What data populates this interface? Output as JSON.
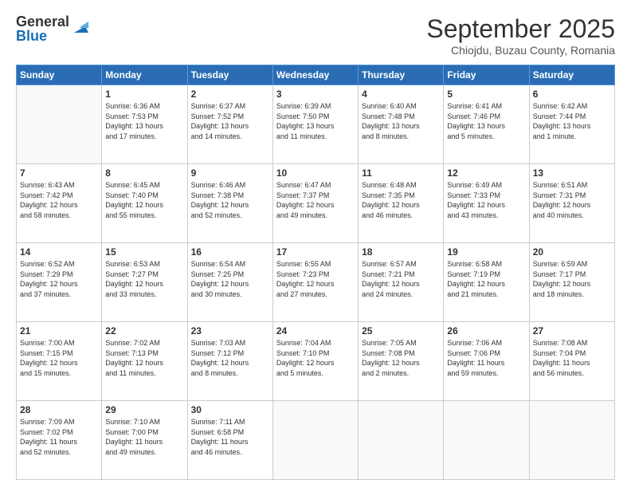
{
  "logo": {
    "general": "General",
    "blue": "Blue"
  },
  "header": {
    "month": "September 2025",
    "location": "Chiojdu, Buzau County, Romania"
  },
  "weekdays": [
    "Sunday",
    "Monday",
    "Tuesday",
    "Wednesday",
    "Thursday",
    "Friday",
    "Saturday"
  ],
  "weeks": [
    [
      {
        "day": "",
        "info": ""
      },
      {
        "day": "1",
        "info": "Sunrise: 6:36 AM\nSunset: 7:53 PM\nDaylight: 13 hours\nand 17 minutes."
      },
      {
        "day": "2",
        "info": "Sunrise: 6:37 AM\nSunset: 7:52 PM\nDaylight: 13 hours\nand 14 minutes."
      },
      {
        "day": "3",
        "info": "Sunrise: 6:39 AM\nSunset: 7:50 PM\nDaylight: 13 hours\nand 11 minutes."
      },
      {
        "day": "4",
        "info": "Sunrise: 6:40 AM\nSunset: 7:48 PM\nDaylight: 13 hours\nand 8 minutes."
      },
      {
        "day": "5",
        "info": "Sunrise: 6:41 AM\nSunset: 7:46 PM\nDaylight: 13 hours\nand 5 minutes."
      },
      {
        "day": "6",
        "info": "Sunrise: 6:42 AM\nSunset: 7:44 PM\nDaylight: 13 hours\nand 1 minute."
      }
    ],
    [
      {
        "day": "7",
        "info": "Sunrise: 6:43 AM\nSunset: 7:42 PM\nDaylight: 12 hours\nand 58 minutes."
      },
      {
        "day": "8",
        "info": "Sunrise: 6:45 AM\nSunset: 7:40 PM\nDaylight: 12 hours\nand 55 minutes."
      },
      {
        "day": "9",
        "info": "Sunrise: 6:46 AM\nSunset: 7:38 PM\nDaylight: 12 hours\nand 52 minutes."
      },
      {
        "day": "10",
        "info": "Sunrise: 6:47 AM\nSunset: 7:37 PM\nDaylight: 12 hours\nand 49 minutes."
      },
      {
        "day": "11",
        "info": "Sunrise: 6:48 AM\nSunset: 7:35 PM\nDaylight: 12 hours\nand 46 minutes."
      },
      {
        "day": "12",
        "info": "Sunrise: 6:49 AM\nSunset: 7:33 PM\nDaylight: 12 hours\nand 43 minutes."
      },
      {
        "day": "13",
        "info": "Sunrise: 6:51 AM\nSunset: 7:31 PM\nDaylight: 12 hours\nand 40 minutes."
      }
    ],
    [
      {
        "day": "14",
        "info": "Sunrise: 6:52 AM\nSunset: 7:29 PM\nDaylight: 12 hours\nand 37 minutes."
      },
      {
        "day": "15",
        "info": "Sunrise: 6:53 AM\nSunset: 7:27 PM\nDaylight: 12 hours\nand 33 minutes."
      },
      {
        "day": "16",
        "info": "Sunrise: 6:54 AM\nSunset: 7:25 PM\nDaylight: 12 hours\nand 30 minutes."
      },
      {
        "day": "17",
        "info": "Sunrise: 6:55 AM\nSunset: 7:23 PM\nDaylight: 12 hours\nand 27 minutes."
      },
      {
        "day": "18",
        "info": "Sunrise: 6:57 AM\nSunset: 7:21 PM\nDaylight: 12 hours\nand 24 minutes."
      },
      {
        "day": "19",
        "info": "Sunrise: 6:58 AM\nSunset: 7:19 PM\nDaylight: 12 hours\nand 21 minutes."
      },
      {
        "day": "20",
        "info": "Sunrise: 6:59 AM\nSunset: 7:17 PM\nDaylight: 12 hours\nand 18 minutes."
      }
    ],
    [
      {
        "day": "21",
        "info": "Sunrise: 7:00 AM\nSunset: 7:15 PM\nDaylight: 12 hours\nand 15 minutes."
      },
      {
        "day": "22",
        "info": "Sunrise: 7:02 AM\nSunset: 7:13 PM\nDaylight: 12 hours\nand 11 minutes."
      },
      {
        "day": "23",
        "info": "Sunrise: 7:03 AM\nSunset: 7:12 PM\nDaylight: 12 hours\nand 8 minutes."
      },
      {
        "day": "24",
        "info": "Sunrise: 7:04 AM\nSunset: 7:10 PM\nDaylight: 12 hours\nand 5 minutes."
      },
      {
        "day": "25",
        "info": "Sunrise: 7:05 AM\nSunset: 7:08 PM\nDaylight: 12 hours\nand 2 minutes."
      },
      {
        "day": "26",
        "info": "Sunrise: 7:06 AM\nSunset: 7:06 PM\nDaylight: 11 hours\nand 59 minutes."
      },
      {
        "day": "27",
        "info": "Sunrise: 7:08 AM\nSunset: 7:04 PM\nDaylight: 11 hours\nand 56 minutes."
      }
    ],
    [
      {
        "day": "28",
        "info": "Sunrise: 7:09 AM\nSunset: 7:02 PM\nDaylight: 11 hours\nand 52 minutes."
      },
      {
        "day": "29",
        "info": "Sunrise: 7:10 AM\nSunset: 7:00 PM\nDaylight: 11 hours\nand 49 minutes."
      },
      {
        "day": "30",
        "info": "Sunrise: 7:11 AM\nSunset: 6:58 PM\nDaylight: 11 hours\nand 46 minutes."
      },
      {
        "day": "",
        "info": ""
      },
      {
        "day": "",
        "info": ""
      },
      {
        "day": "",
        "info": ""
      },
      {
        "day": "",
        "info": ""
      }
    ]
  ]
}
